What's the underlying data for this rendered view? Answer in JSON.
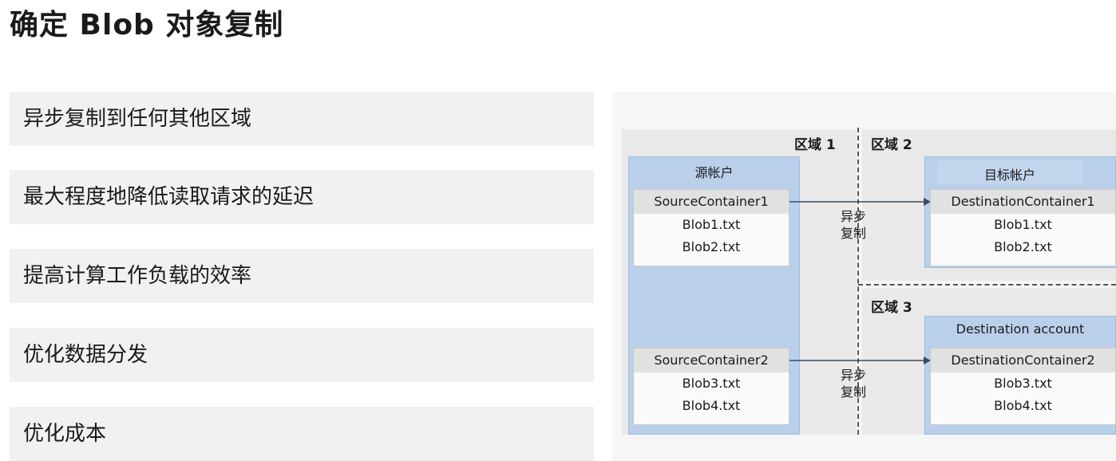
{
  "title": "确定 Blob 对象复制",
  "bullets": [
    "异步复制到任何其他区域",
    "最大程度地降低读取请求的延迟",
    "提高计算工作负载的效率",
    "优化数据分发",
    "优化成本"
  ],
  "diagram": {
    "regions": {
      "r1": "区域 1",
      "r2": "区域 2",
      "r3": "区域 3"
    },
    "source_account": {
      "title": "源帐户",
      "containers": [
        {
          "name": "SourceContainer1",
          "blobs": [
            "Blob1.txt",
            "Blob2.txt"
          ]
        },
        {
          "name": "SourceContainer2",
          "blobs": [
            "Blob3.txt",
            "Blob4.txt"
          ]
        }
      ]
    },
    "dest_account_1": {
      "title": "目标帐户",
      "container": {
        "name": "DestinationContainer1",
        "blobs": [
          "Blob1.txt",
          "Blob2.txt"
        ]
      }
    },
    "dest_account_2": {
      "title": "Destination account",
      "container": {
        "name": "DestinationContainer2",
        "blobs": [
          "Blob3.txt",
          "Blob4.txt"
        ]
      }
    },
    "arrow_labels": [
      [
        "异步",
        "复制"
      ],
      [
        "异步",
        "复制"
      ]
    ]
  }
}
